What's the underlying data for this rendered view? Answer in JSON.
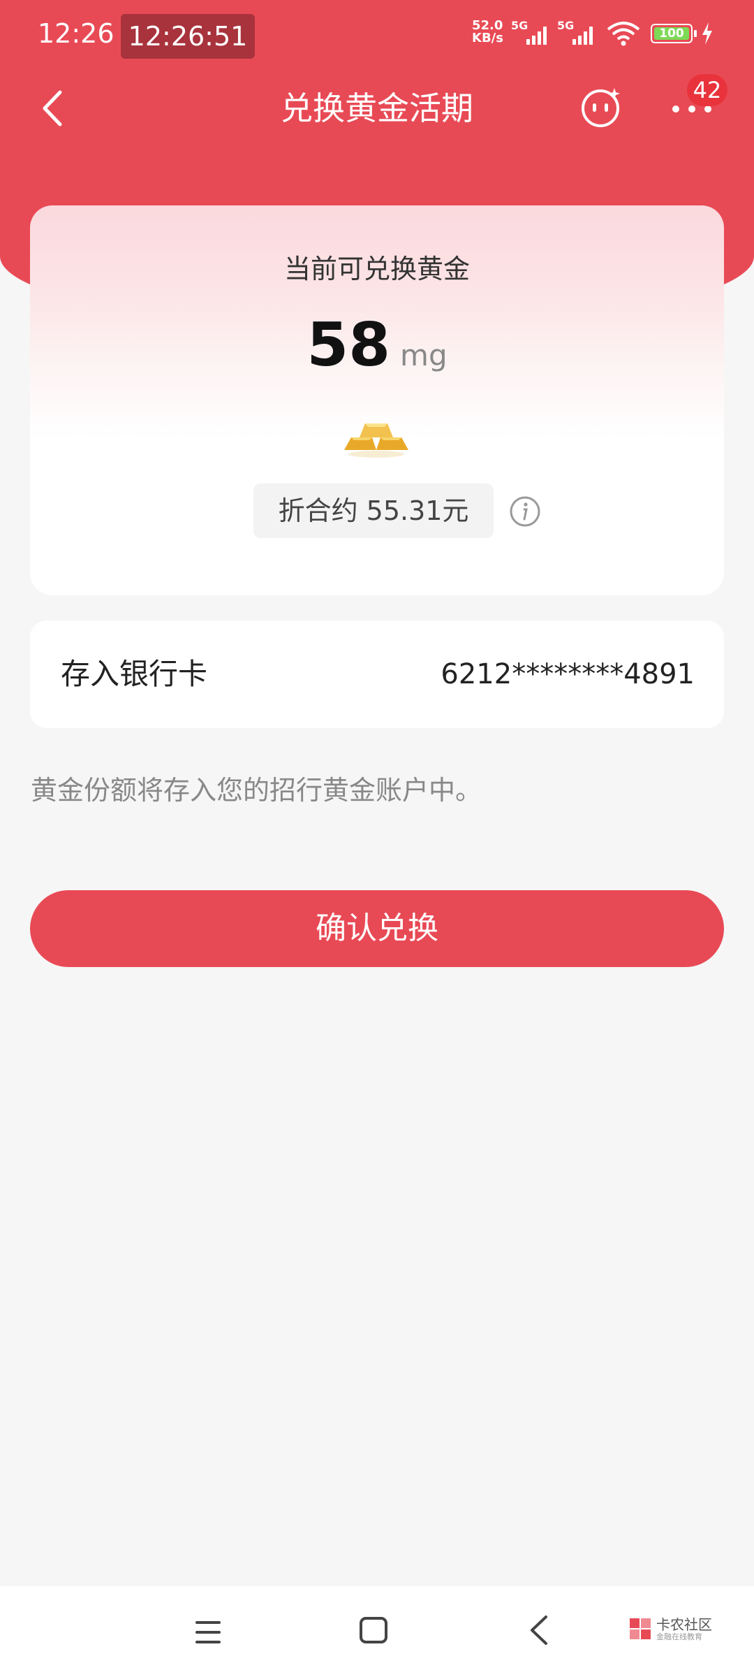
{
  "status_bar": {
    "time": "12:26",
    "clock": "12:26:51",
    "net_speed": "52.0",
    "net_unit": "KB/s",
    "network": "5G",
    "battery": "100"
  },
  "nav": {
    "title": "兑换黄金活期",
    "badge": "42"
  },
  "card": {
    "label": "当前可兑换黄金",
    "amount": "58",
    "unit": "mg",
    "approx": "折合约 55.31元"
  },
  "bank": {
    "label": "存入银行卡",
    "card_number": "6212********4891"
  },
  "notice": "黄金份额将存入您的招行黄金账户中。",
  "confirm_label": "确认兑换",
  "watermark": {
    "title": "卡农社区",
    "subtitle": "金融在线教育"
  },
  "colors": {
    "primary": "#e84a55",
    "background": "#f6f6f6",
    "badge": "#e8333c",
    "gold": "#f2c14e"
  }
}
